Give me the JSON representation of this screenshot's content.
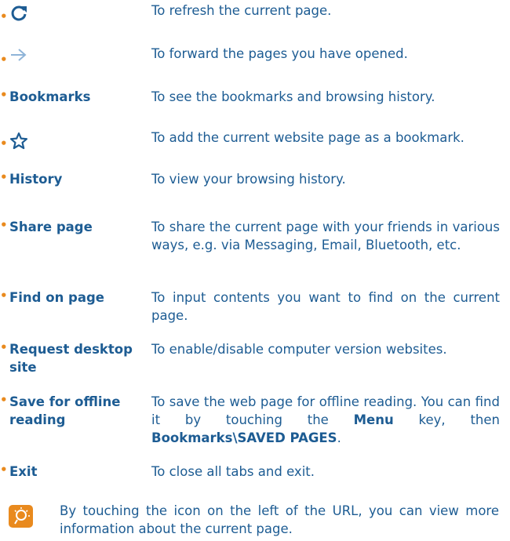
{
  "items": [
    {
      "term": "",
      "desc": "To refresh the current page.",
      "icon": "refresh-icon"
    },
    {
      "term": "",
      "desc": "To forward the pages you have opened.",
      "icon": "forward-arrow-icon"
    },
    {
      "term": "Bookmarks",
      "desc": "To see the bookmarks and browsing history."
    },
    {
      "term": "",
      "desc": "To add the current website page as a bookmark.",
      "icon": "star-outline-icon"
    },
    {
      "term": "History",
      "desc": "To view your browsing history."
    },
    {
      "term": "Share page",
      "desc": "To share the current page with your friends in various ways, e.g. via Messaging, Email, Bluetooth, etc."
    },
    {
      "term": "Find on page",
      "desc": "To input contents you want to find on the current page."
    },
    {
      "term": "Request desktop site",
      "desc": "To enable/disable computer version websites."
    },
    {
      "term": "Save for offline reading",
      "desc_parts": [
        "To save the web page for offline reading. You can find it by touching the ",
        "Menu",
        " key, then ",
        "Bookmarks\\SAVED PAGES",
        "."
      ]
    },
    {
      "term": "Exit",
      "desc": "To close all tabs and exit."
    }
  ],
  "bullet_char": "•",
  "tip": {
    "icon": "lightbulb-tip-icon",
    "text": "By touching the icon on the left of the URL, you can view more information about the current page."
  },
  "colors": {
    "text": "#1d5c93",
    "accent": "#e98a1e"
  }
}
